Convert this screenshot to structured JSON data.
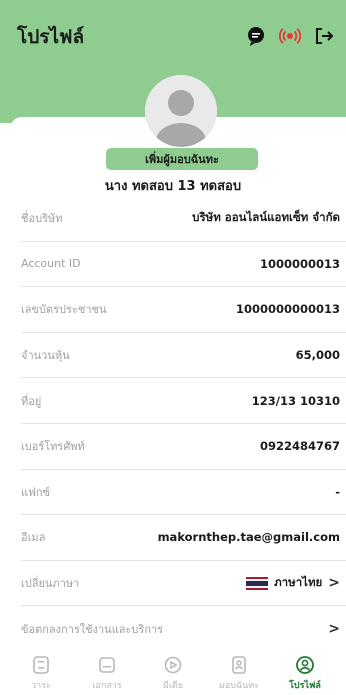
{
  "header": {
    "title": "โปรไฟล์",
    "icons": [
      "chat-icon",
      "broadcast-icon",
      "logout-icon"
    ],
    "color": "#8ecc8f"
  },
  "profile": {
    "add_authorizer_label": "เพิ่มผู้มอบฉันทะ",
    "name": "นาง ทดสอบ 13 ทดสอบ"
  },
  "rows": [
    {
      "label": "ชื่อบริษัท",
      "value": "บริษัท ออนไลน์แอทเซ็ท จำกัด"
    },
    {
      "label": "Account ID",
      "value": "1000000013"
    },
    {
      "label": "เลขบัตรประชาชน",
      "value": "1000000000013"
    },
    {
      "label": "จำนวนหุ้น",
      "value": "65,000"
    },
    {
      "label": "ที่อยู่",
      "value": "123/13 10310"
    },
    {
      "label": "เบอร์โทรศัพท์",
      "value": "0922484767"
    },
    {
      "label": "แฟกซ์",
      "value": "-"
    },
    {
      "label": "อีเมล",
      "value": "makornthep.tae@gmail.com"
    },
    {
      "label": "เปลี่ยนภาษา",
      "value": "ภาษาไทย",
      "chevron": ">"
    },
    {
      "label": "ข้อตกลงการใช้งานและบริการ",
      "value": "",
      "chevron": ">"
    }
  ],
  "nav": [
    {
      "label": "วาระ",
      "icon": "agenda-icon",
      "active": false
    },
    {
      "label": "เอกสาร",
      "icon": "document-icon",
      "active": false
    },
    {
      "label": "มีเดีย",
      "icon": "media-icon",
      "active": false
    },
    {
      "label": "มอบฉันทะ",
      "icon": "proxy-icon",
      "active": false
    },
    {
      "label": "โปรไฟล์",
      "icon": "profile-icon",
      "active": true
    }
  ],
  "accent": "#1f7a2f"
}
